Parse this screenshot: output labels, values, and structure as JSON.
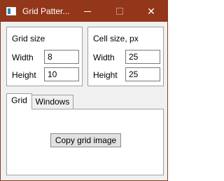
{
  "window": {
    "title": "Grid Patter...",
    "controls": {
      "minimize_icon": "minimize-icon",
      "maximize_icon": "maximize-icon",
      "close_icon": "close-icon",
      "close_glyph": "✕"
    }
  },
  "grid_size": {
    "title": "Grid size",
    "width_label": "Width",
    "width_value": "8",
    "height_label": "Height",
    "height_value": "10"
  },
  "cell_size": {
    "title": "Cell size, px",
    "width_label": "Width",
    "width_value": "25",
    "height_label": "Height",
    "height_value": "25"
  },
  "tabs": [
    {
      "label": "Grid",
      "active": true
    },
    {
      "label": "Windows",
      "active": false
    }
  ],
  "grid_tab": {
    "copy_button_label": "Copy grid image"
  },
  "colors": {
    "titlebar": "#93361a",
    "window_bg": "#f0f0f0",
    "panel_bg": "#ffffff"
  }
}
